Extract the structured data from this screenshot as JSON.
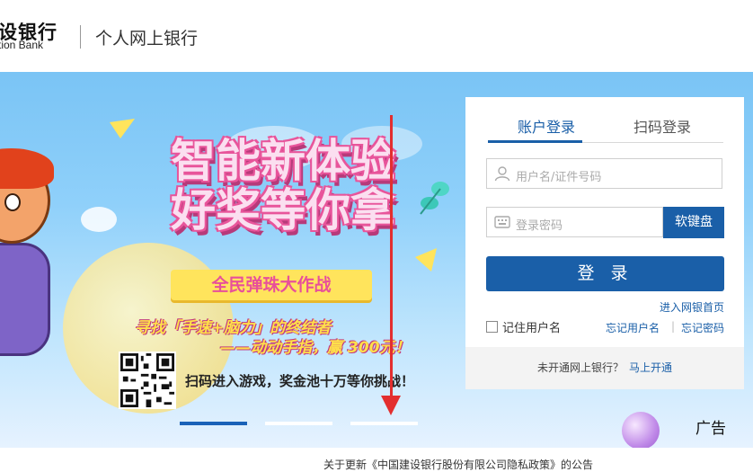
{
  "header": {
    "logo_cn": "设银行",
    "logo_en": "tion Bank",
    "site_title": "个人网上银行"
  },
  "banner": {
    "headline_line1": "智能新体验",
    "headline_line2": "好奖等你拿",
    "tag": "全民弹珠大作战",
    "slogan1": "寻找「手速+脑力」的终结者",
    "slogan2": "——动动手指，赢 300元！",
    "scan_text": "扫码进入游戏，奖金池十万等你挑战！",
    "ad_label": "广告",
    "carousel_active_index": 0
  },
  "login": {
    "tab_account": "账户登录",
    "tab_qr": "扫码登录",
    "username_placeholder": "用户名/证件号码",
    "password_placeholder": "登录密码",
    "soft_keyboard": "软键盘",
    "login_button": "登 录",
    "enter_homepage": "进入网银首页",
    "remember_user": "记住用户名",
    "forgot_username": "忘记用户名",
    "separator": "|",
    "forgot_password": "忘记密码",
    "not_enrolled": "未开通网上银行？",
    "enroll_now": "马上开通"
  },
  "notice": {
    "text": "关于更新《中国建设银行股份有限公司隐私政策》的公告"
  },
  "colors": {
    "brand_blue": "#1a5fa8",
    "annotation_red": "#e32e2e"
  }
}
